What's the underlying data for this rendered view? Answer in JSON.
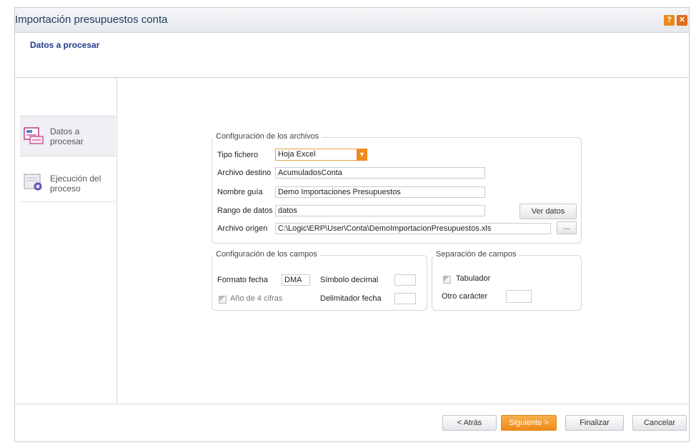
{
  "window": {
    "title": "Importación presupuestos conta"
  },
  "header": {
    "title": "Datos a procesar"
  },
  "nav": {
    "items": [
      {
        "label": "Datos a procesar",
        "active": true
      },
      {
        "label": "Ejecución del proceso",
        "active": false
      }
    ]
  },
  "archivos": {
    "legend": "Configuración de los archivos",
    "tipo_fichero": {
      "label": "Tipo fichero",
      "value": "Hoja Excel"
    },
    "archivo_destino": {
      "label": "Archivo destino",
      "value": "AcumuladosConta"
    },
    "nombre_guia": {
      "label": "Nombre guía",
      "value": "Demo Importaciones Presupuestos"
    },
    "rango_datos": {
      "label": "Rango de datos",
      "value": "datos"
    },
    "archivo_origen": {
      "label": "Archivo origen",
      "value": "C:\\Logic\\ERP\\User\\Conta\\DemoImportacionPresupuestos.xls"
    },
    "ver_datos_label": "Ver datos",
    "browse_label": "..."
  },
  "campos": {
    "legend": "Configuración de los campos",
    "formato_fecha": {
      "label": "Formato fecha",
      "value": "DMA"
    },
    "simbolo_decimal": {
      "label": "Símbolo decimal",
      "value": ""
    },
    "anio_4_cifras": {
      "label": "Año de 4 cifras",
      "checked": false
    },
    "delimitador_fecha": {
      "label": "Delimitador fecha",
      "value": ""
    }
  },
  "separacion": {
    "legend": "Separación de campos",
    "tabulador": {
      "label": "Tabulador",
      "checked": false
    },
    "otro_caracter": {
      "label": "Otro carácter",
      "value": ""
    }
  },
  "footer": {
    "atras": "< Atrás",
    "siguiente": "Siguiente >",
    "finalizar": "Finalizar",
    "cancelar": "Cancelar"
  },
  "colors": {
    "accent": "#ee8a18",
    "title": "#1f3a5a",
    "header_title": "#1f3a8a"
  }
}
